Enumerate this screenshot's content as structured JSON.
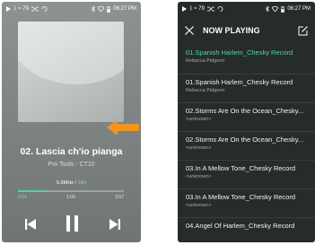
{
  "player": {
    "status": {
      "signal": "ᛒ ≈ 79",
      "time": "06:27 PM"
    },
    "track_title": "02. Lascia ch'io pianga",
    "album": "Pro Tools - CT10",
    "quality": {
      "rate": "5.6MHz /",
      "bits": "1Bit"
    },
    "progress_fraction": 0.25,
    "time_elapsed": "0:54",
    "time_middle": "1:00",
    "time_total": "3:57",
    "accent_color": "#54d2a6",
    "arrow_color": "#f0951f",
    "icons": [
      "previous-icon",
      "pause-icon",
      "next-icon"
    ]
  },
  "now_playing": {
    "status": {
      "signal": "ᛒ ≈ 79",
      "time": "06:27 PM"
    },
    "title": "NOW PLAYING",
    "items": [
      {
        "title": "01.Spanish Harlem_Chesky Record",
        "artist": "Rebecca Pidgeon",
        "active": true
      },
      {
        "title": "01.Spanish Harlem_Chesky Record",
        "artist": "Rebecca Pidgeon"
      },
      {
        "title": "02.Storms Are On the Ocean_Chesky...",
        "artist": "<unknown>"
      },
      {
        "title": "02.Storms Are On the Ocean_Chesky...",
        "artist": "<unknown>"
      },
      {
        "title": "03.In A Mellow Tone_Chesky Record",
        "artist": "<unknown>"
      },
      {
        "title": "03.In A Mellow Tone_Chesky Record",
        "artist": "<unknown>"
      },
      {
        "title": "04.Angel Of Harlem_Chesky Record",
        "artist": ""
      }
    ],
    "active_color": "#4fd8a5"
  }
}
